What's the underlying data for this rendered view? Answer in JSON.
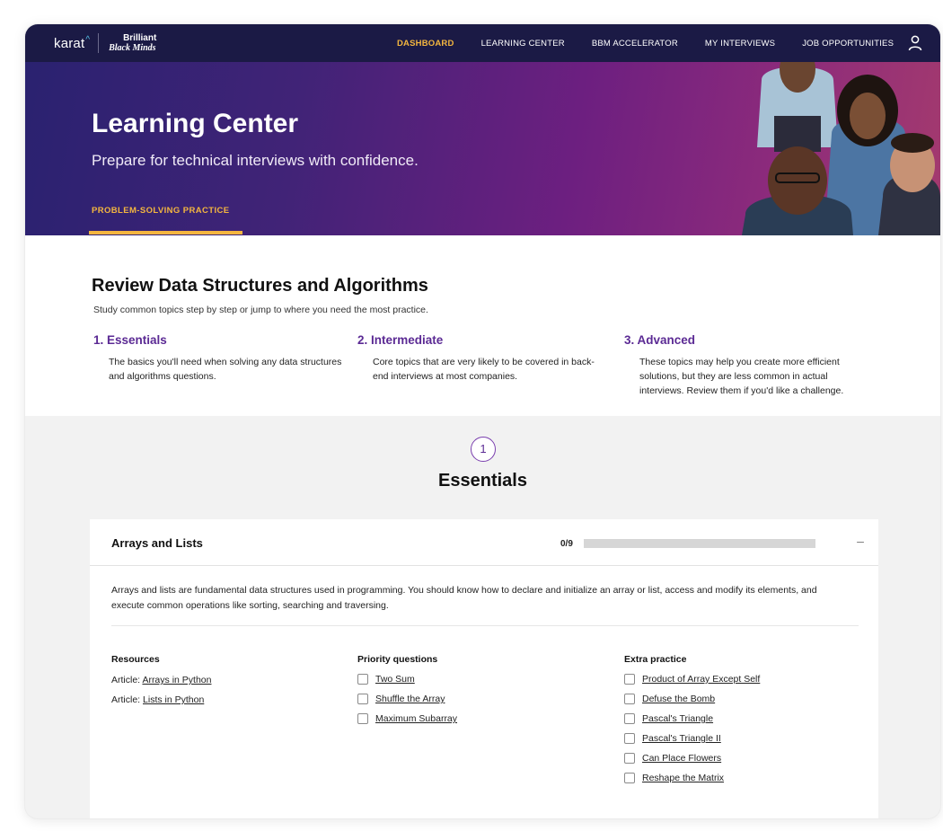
{
  "nav": {
    "brand": "karat",
    "brand_partner_line1": "Brilliant",
    "brand_partner_line2": "Black Minds",
    "links": [
      "DASHBOARD",
      "LEARNING CENTER",
      "BBM ACCELERATOR",
      "MY INTERVIEWS",
      "JOB OPPORTUNITIES"
    ],
    "active_link": "DASHBOARD",
    "user_icon": "user-icon"
  },
  "hero": {
    "title": "Learning Center",
    "subtitle": "Prepare for technical interviews with confidence.",
    "tab": "PROBLEM-SOLVING PRACTICE"
  },
  "review": {
    "title": "Review Data Structures and Algorithms",
    "description": "Study common topics step by step or jump to where you need the most practice.",
    "levels": [
      {
        "title": "1. Essentials",
        "description": "The basics you'll need when solving any data structures and algorithms questions."
      },
      {
        "title": "2. Intermediate",
        "description": "Core topics that are very likely to be covered in back-end interviews at most companies."
      },
      {
        "title": "3. Advanced",
        "description": "These topics may help you create more efficient solutions, but they are less common in actual interviews. Review them if you'd like a challenge."
      }
    ]
  },
  "section": {
    "step_number": "1",
    "title": "Essentials"
  },
  "topic": {
    "title": "Arrays and Lists",
    "progress_label": "0/9",
    "progress_fraction": 0,
    "collapse_symbol": "–",
    "description": "Arrays and lists are fundamental data structures used in programming. You should know how to declare and initialize an array or list, access and modify its elements, and execute common operations like sorting, searching and traversing.",
    "resources": {
      "title": "Resources",
      "items": [
        {
          "prefix": "Article: ",
          "link": "Arrays in Python"
        },
        {
          "prefix": "Article: ",
          "link": "Lists in Python"
        }
      ]
    },
    "priority": {
      "title": "Priority questions",
      "items": [
        "Two Sum",
        "Shuffle the Array",
        "Maximum Subarray"
      ]
    },
    "extra": {
      "title": "Extra practice",
      "items": [
        "Product of Array Except Self",
        "Defuse the Bomb",
        "Pascal's Triangle",
        "Pascal's Triangle II",
        "Can Place Flowers",
        "Reshape the Matrix"
      ]
    }
  },
  "colors": {
    "nav_bg": "#1b1a45",
    "accent_gold": "#f4b63f",
    "accent_purple": "#5b2a94"
  }
}
